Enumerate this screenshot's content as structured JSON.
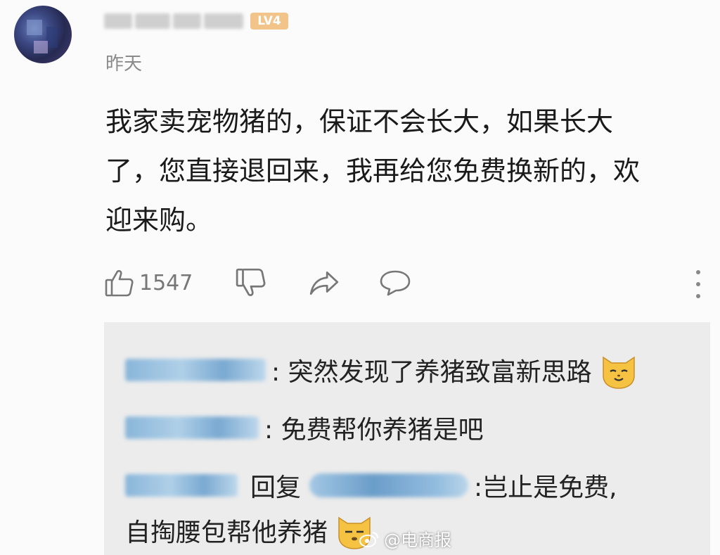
{
  "user": {
    "level_badge": "LV4",
    "time": "昨天"
  },
  "comment": {
    "lines": [
      "我家卖宠物猪的，保证不会长大，如果长大",
      "了，您直接退回来，我再给您免费换新的，欢",
      "迎来购。"
    ]
  },
  "actions": {
    "like_count": "1547",
    "icons": [
      "thumbs-up-icon",
      "thumbs-down-icon",
      "share-icon",
      "comment-icon",
      "more-vertical-icon"
    ]
  },
  "replies": [
    {
      "text": ": 突然发现了养猪致富新思路",
      "emoji": "cat-face-icon"
    },
    {
      "text": ": 免费帮你养猪是吧"
    },
    {
      "reply_word": "回复",
      "text_line1": ":岂止是免费,",
      "text_line2": "自掏腰包帮他养猪",
      "emoji": "cat-face-icon"
    }
  ],
  "watermark": {
    "text": "@电商报"
  },
  "colors": {
    "background": "#fbfbfb",
    "reply_box": "#ececec",
    "level_badge": "#f3c48a",
    "secondary_text": "#8a8a8a"
  }
}
